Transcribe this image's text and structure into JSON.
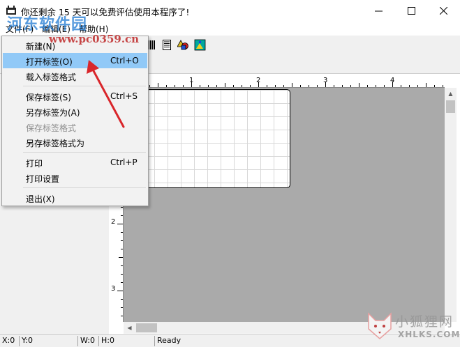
{
  "window": {
    "title": "你还剩余 15 天可以免费评估使用本程序了!",
    "minimize": "—",
    "maximize": "☐",
    "close": "✕"
  },
  "menubar": {
    "file": "文件(F)",
    "edit": "编辑(E)",
    "help": "帮助(H)"
  },
  "file_menu": {
    "items": [
      {
        "label": "新建(N)",
        "shortcut": ""
      },
      {
        "label": "打开标签(O)",
        "shortcut": "Ctrl+O"
      },
      {
        "label": "载入标签格式",
        "shortcut": ""
      },
      {
        "label": "保存标签(S)",
        "shortcut": "Ctrl+S"
      },
      {
        "label": "另存标签为(A)",
        "shortcut": ""
      },
      {
        "label": "保存标签格式",
        "shortcut": ""
      },
      {
        "label": "另存标签格式为",
        "shortcut": ""
      },
      {
        "label": "打印",
        "shortcut": "Ctrl+P"
      },
      {
        "label": "打印设置",
        "shortcut": ""
      },
      {
        "label": "退出(X)",
        "shortcut": ""
      }
    ],
    "highlighted_index": 1,
    "disabled_index": 5
  },
  "ruler": {
    "top": [
      "1",
      "2",
      "3",
      "4"
    ],
    "left": [
      "2",
      "3"
    ]
  },
  "statusbar": {
    "x": "X:0",
    "y": "Y:0",
    "w": "W:0",
    "h": "H:0",
    "status": "Ready"
  },
  "watermark": {
    "site_name": "河东软件园",
    "site_url": "www.pc0359.cn",
    "brand_cn": "小狐狸网",
    "brand_en": "XHLKS.COM"
  },
  "colors": {
    "highlight": "#91c9f7",
    "workspace": "#aaaaaa",
    "annotation_arrow": "#d9262b"
  }
}
